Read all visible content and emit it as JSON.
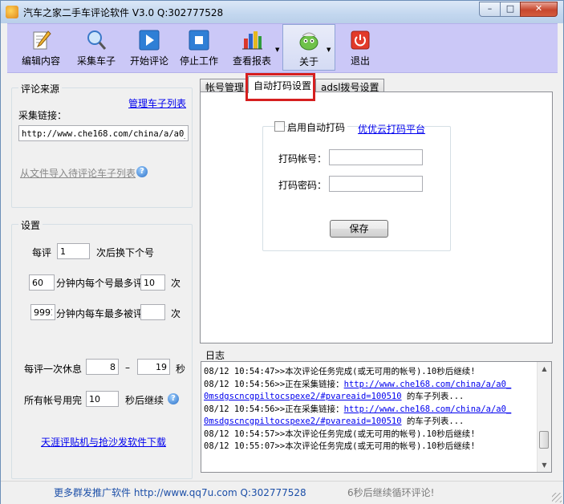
{
  "window": {
    "title": "汽车之家二手车评论软件 V3.0 Q:302777528",
    "min": "–",
    "max": "□",
    "close": "✕"
  },
  "toolbar": {
    "items": [
      {
        "label": "编辑内容",
        "icon": "edit-icon"
      },
      {
        "label": "采集车子",
        "icon": "magnifier-icon"
      },
      {
        "label": "开始评论",
        "icon": "play-icon"
      },
      {
        "label": "停止工作",
        "icon": "stop-icon"
      },
      {
        "label": "查看报表",
        "icon": "bar-chart-icon"
      },
      {
        "label": "关于",
        "icon": "mascot-icon"
      },
      {
        "label": "退出",
        "icon": "power-icon"
      }
    ],
    "dropdown_arrow": "▼"
  },
  "source": {
    "group_title": "评论来源",
    "manage_link": "管理车子列表",
    "collect_label": "采集链接：",
    "collect_url": "http://www.che168.com/china/a/a0_0r",
    "import_link": "从文件导入待评论车子列表",
    "help": "?"
  },
  "settings": {
    "group_title": "设置",
    "per_comment_label": "每评",
    "per_comment_value": "1",
    "per_comment_suffix": "次后换下个号",
    "minutes1_value": "60",
    "minutes1_label": "分钟内每个号最多评",
    "max_comments_value": "10",
    "times1": "次",
    "minutes2_value": "9991",
    "minutes2_label": "分钟内每车最多被评",
    "max_per_car_value": "",
    "times2": "次",
    "rest_label": "每评一次休息",
    "rest_min": "8",
    "dash": "–",
    "rest_max": "19",
    "seconds": "秒",
    "all_used_label": "所有帐号用完",
    "all_used_value": "10",
    "continue_label": "秒后继续",
    "help": "?",
    "download_link": "天涯评贴机与抢沙发软件下载"
  },
  "tabs": [
    {
      "label": "帐号管理",
      "selected": false
    },
    {
      "label": "自动打码设置",
      "selected": true
    },
    {
      "label": "adsl拨号设置",
      "selected": false
    }
  ],
  "captcha": {
    "enable_label": "启用自动打码",
    "platform_link": "优优云打码平台",
    "account_label": "打码帐号：",
    "account_value": "",
    "password_label": "打码密码：",
    "password_value": "",
    "save_button": "保存"
  },
  "log": {
    "label": "日志",
    "lines": [
      [
        {
          "t": "08/12 10:54:47>>本次评论任务完成(或无可用的帐号).10秒后继续!",
          "link": false
        }
      ],
      [
        {
          "t": "08/12 10:54:56>>正在采集链接：",
          "link": false
        },
        {
          "t": "http://www.che168.com/china/a/a0_",
          "link": true
        }
      ],
      [
        {
          "t": "0msdgscncgpiltocspexe2/#pvareaid=100510",
          "link": true
        },
        {
          "t": " 的车子列表...",
          "link": false
        }
      ],
      [
        {
          "t": "08/12 10:54:56>>正在采集链接：",
          "link": false
        },
        {
          "t": "http://www.che168.com/china/a/a0_",
          "link": true
        }
      ],
      [
        {
          "t": "0msdgscncgpiltocspexe2/#pvareaid=100510",
          "link": true
        },
        {
          "t": " 的车子列表...",
          "link": false
        }
      ],
      [
        {
          "t": "08/12 10:54:57>>本次评论任务完成(或无可用的帐号).10秒后继续!",
          "link": false
        }
      ],
      [
        {
          "t": "08/12 10:55:07>>本次评论任务完成(或无可用的帐号).10秒后继续!",
          "link": false
        }
      ]
    ]
  },
  "status": {
    "left": "更多群发推广软件 http://www.qq7u.com Q:302777528",
    "right": "6秒后继续循环评论!"
  },
  "colors": {
    "toolbar_bg": "#cbc8f7",
    "link": "#0000ee",
    "highlight": "#d61f1f"
  }
}
